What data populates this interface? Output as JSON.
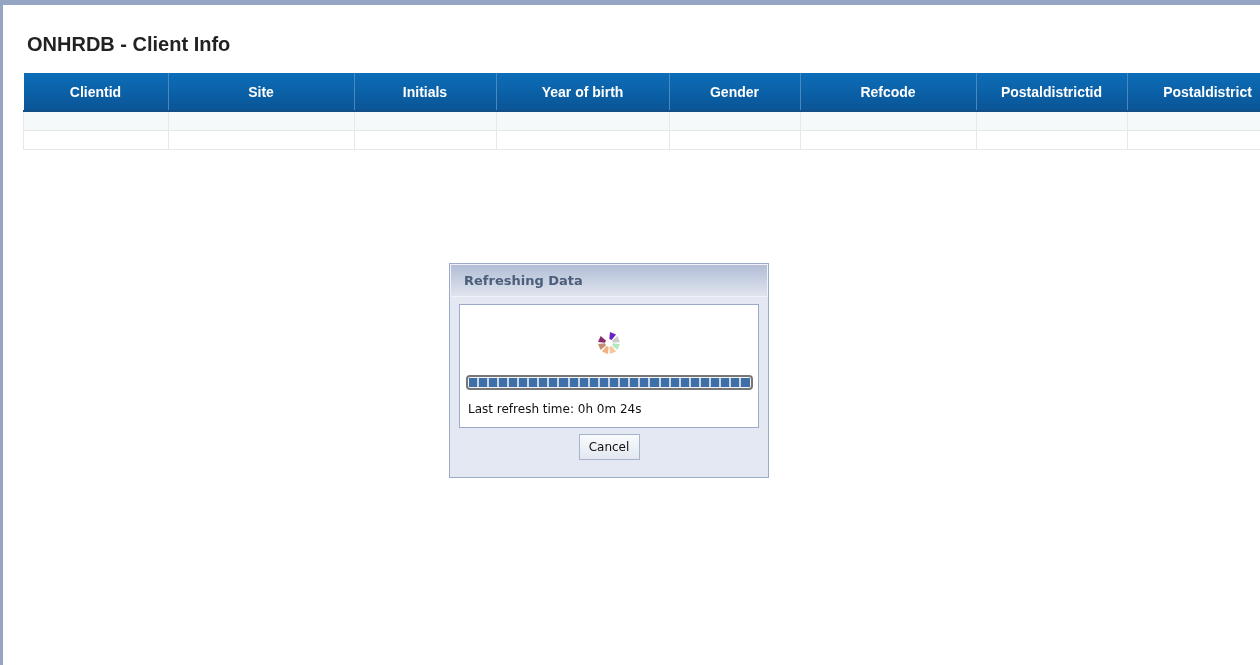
{
  "page": {
    "title": "ONHRDB - Client Info"
  },
  "table": {
    "columns": [
      "Clientid",
      "Site",
      "Initials",
      "Year of birth",
      "Gender",
      "Refcode",
      "Postaldistrictid",
      "Postaldistrict"
    ]
  },
  "dialog": {
    "title": "Refreshing Data",
    "progress": {
      "level": 1
    },
    "status": "Last refresh time: 0h 0m 24s",
    "buttons": [
      "Cancel"
    ]
  }
}
